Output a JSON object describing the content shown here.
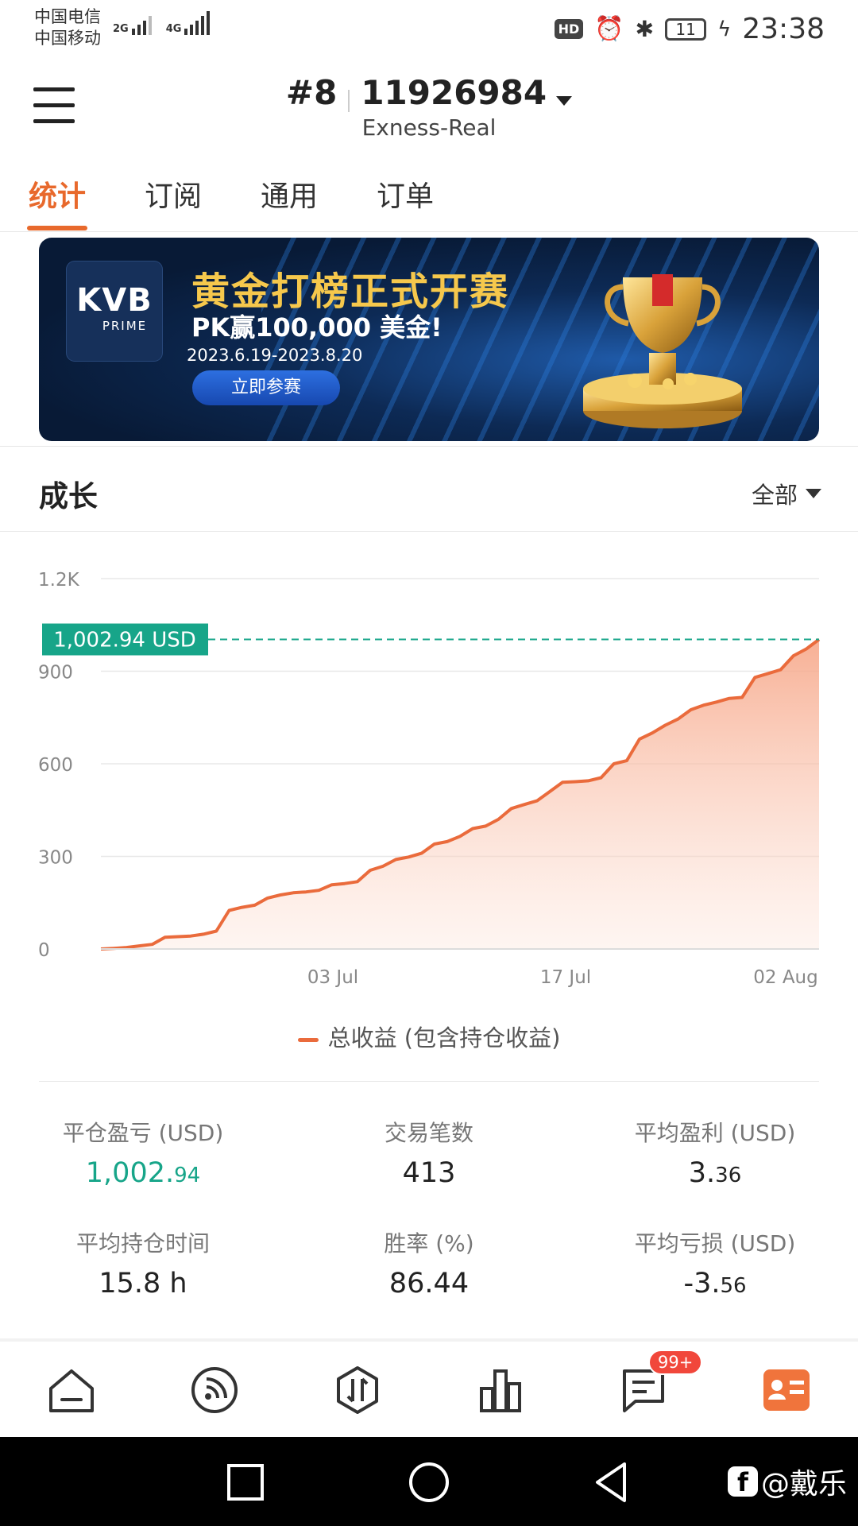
{
  "status_bar": {
    "carrier1": "中国电信",
    "carrier2": "中国移动",
    "net1": "2G",
    "net2": "4G",
    "hd": "HD",
    "battery": "11",
    "time": "23:38"
  },
  "header": {
    "rank": "#8",
    "account": "11926984",
    "server": "Exness-Real"
  },
  "tabs": [
    "统计",
    "订阅",
    "通用",
    "订单"
  ],
  "banner": {
    "logo_big": "KVB",
    "logo_small": "PRIME",
    "title": "黄金打榜正式开赛",
    "subtitle": "PK赢100,000 美金!",
    "dates": "2023.6.19-2023.8.20",
    "cta": "立即参赛"
  },
  "growth": {
    "title": "成长",
    "range": "全部"
  },
  "chart_data": {
    "type": "area",
    "x_ticks": [
      "03 Jul",
      "17 Jul",
      "02 Aug"
    ],
    "y_ticks": [
      "0",
      "300",
      "600",
      "900",
      "1.2K"
    ],
    "ylim": [
      0,
      1200
    ],
    "marker_label": "1,002.94 USD",
    "marker_value": 1002.94,
    "series": [
      {
        "name": "总收益 (包含持仓收益)",
        "color": "#ea6b3c",
        "values": [
          0,
          2,
          5,
          10,
          15,
          38,
          40,
          42,
          48,
          58,
          125,
          135,
          142,
          165,
          175,
          182,
          185,
          190,
          208,
          212,
          218,
          255,
          268,
          290,
          298,
          310,
          340,
          348,
          365,
          390,
          398,
          420,
          455,
          468,
          480,
          510,
          540,
          542,
          545,
          555,
          600,
          610,
          680,
          700,
          725,
          745,
          775,
          790,
          800,
          812,
          815,
          880,
          892,
          905,
          950,
          972,
          1002.94
        ]
      }
    ]
  },
  "stats": [
    {
      "label": "平仓盈亏 (USD)",
      "main": "1,002.",
      "dec": "94",
      "green": true
    },
    {
      "label": "交易笔数",
      "main": "413",
      "dec": "",
      "green": false
    },
    {
      "label": "平均盈利 (USD)",
      "main": "3.",
      "dec": "36",
      "green": false
    },
    {
      "label": "平均持仓时间",
      "main": "15.8 h",
      "dec": "",
      "green": false
    },
    {
      "label": "胜率 (%)",
      "main": "86.44",
      "dec": "",
      "green": false
    },
    {
      "label": "平均亏损 (USD)",
      "main": "-3.",
      "dec": "56",
      "green": false
    }
  ],
  "nav": {
    "badge": "99+",
    "accent": "#f0743c"
  },
  "watermark": "@戴乐"
}
